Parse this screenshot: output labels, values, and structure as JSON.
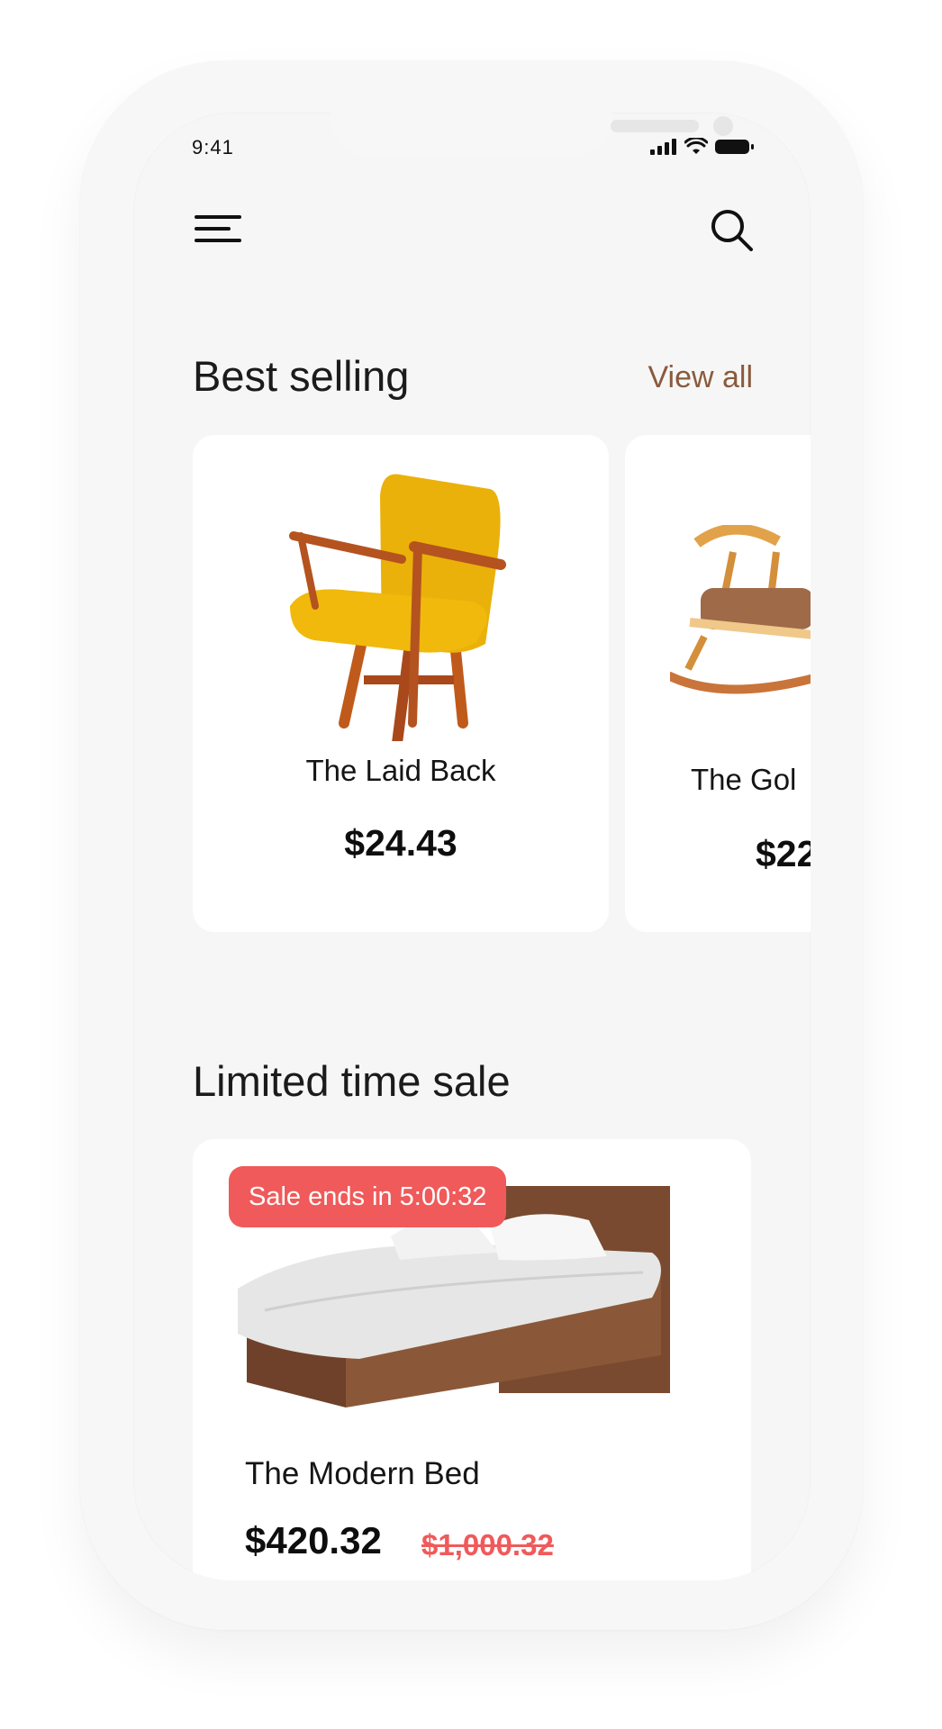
{
  "status_bar": {
    "time": "9:41"
  },
  "header": {
    "menu_icon": "hamburger-menu-icon",
    "search_icon": "search-icon"
  },
  "best_selling": {
    "title": "Best selling",
    "view_all": "View all",
    "products": [
      {
        "name": "The Laid Back",
        "price": "$24.43",
        "image": "yellow-lounge-chair"
      },
      {
        "name": "The Gol",
        "price": "$22",
        "image": "wooden-rocking-chair"
      }
    ]
  },
  "limited_sale": {
    "title": "Limited time sale",
    "badge": "Sale ends in 5:00:32",
    "product": {
      "name": "The Modern Bed",
      "price": "$420.32",
      "old_price": "$1,000.32",
      "image": "wooden-bed"
    }
  },
  "colors": {
    "accent": "#8a5a3c",
    "sale": "#f05a5a",
    "background": "#f6f6f6",
    "card": "#ffffff"
  }
}
